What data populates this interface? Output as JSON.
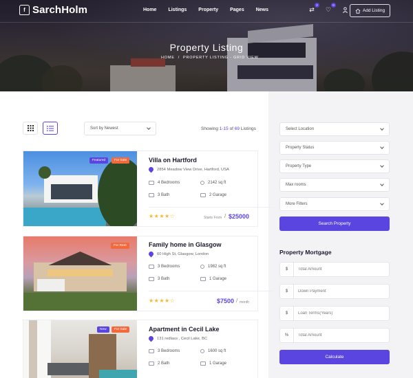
{
  "header": {
    "logo": "SarchHolm",
    "logo_mark": "f",
    "nav": [
      "Home",
      "Listings",
      "Property",
      "Pages",
      "News"
    ],
    "compare_count": "2",
    "wishlist_count": "0",
    "add_listing": "Add Listing"
  },
  "hero": {
    "title": "Property Listing",
    "crumb_home": "HOME",
    "crumb_sep": "/",
    "crumb_current": "PROPERTY LISTING - GRID VIEW"
  },
  "toolbar": {
    "sort_label": "Sort by Newest",
    "showing_prefix": "Showing ",
    "showing_range": "1-15",
    "showing_of": " of ",
    "showing_total": "69",
    "showing_suffix": " Listings"
  },
  "listings": [
    {
      "title": "Villa on Hartford",
      "address": "2854 Meadow View Drive, Hartford, USA",
      "badges": [
        "Featured",
        "For Sale"
      ],
      "bedrooms": "4 Bedrooms",
      "area": "2142 sq ft",
      "bath": "3 Bath",
      "garage": "2 Garage",
      "rating": 4.5,
      "price_note": "Starts From",
      "price_sep": "/",
      "price": "$25000"
    },
    {
      "title": "Family home in Glasgow",
      "address": "60 High St, Glasgow, London",
      "badges": [
        "For Rent"
      ],
      "bedrooms": "3 Bedrooms",
      "area": "1982 sq ft",
      "bath": "3 Bath",
      "garage": "1 Garage",
      "rating": 4.5,
      "price": "$7500",
      "price_sep": "/",
      "price_note": "month"
    },
    {
      "title": "Apartment in Cecil Lake",
      "address": "131 redlass , Cecil Lake, BC",
      "badges": [
        "New",
        "For Sale"
      ],
      "bedrooms": "3 Bedrooms",
      "area": "1600 sq ft",
      "bath": "2 Bath",
      "garage": "1 Garage"
    }
  ],
  "filters": {
    "location": "Select Location",
    "status": "Property Status",
    "type": "Property Type",
    "rooms": "Max rooms",
    "more": "More Filters",
    "search_button": "Search Property"
  },
  "mortgage": {
    "title": "Property Mortgage",
    "fields": [
      {
        "prefix": "$",
        "placeholder": "Total Amount"
      },
      {
        "prefix": "$",
        "placeholder": "Down Payment"
      },
      {
        "prefix": "$",
        "placeholder": "Loan Terms(Years)"
      },
      {
        "prefix": "%",
        "placeholder": "Total Amount"
      }
    ],
    "calculate": "Calculate"
  },
  "colors": {
    "accent": "#5a45e0",
    "sale": "#f26a3c",
    "star": "#f5b82e",
    "sidebar_bg": "#f3f3f6"
  },
  "icons": {
    "grid_view": "grid-icon",
    "list_view": "list-icon",
    "compare": "compare-icon",
    "wishlist": "heart-icon",
    "account": "user-icon",
    "add_listing": "home-icon"
  }
}
